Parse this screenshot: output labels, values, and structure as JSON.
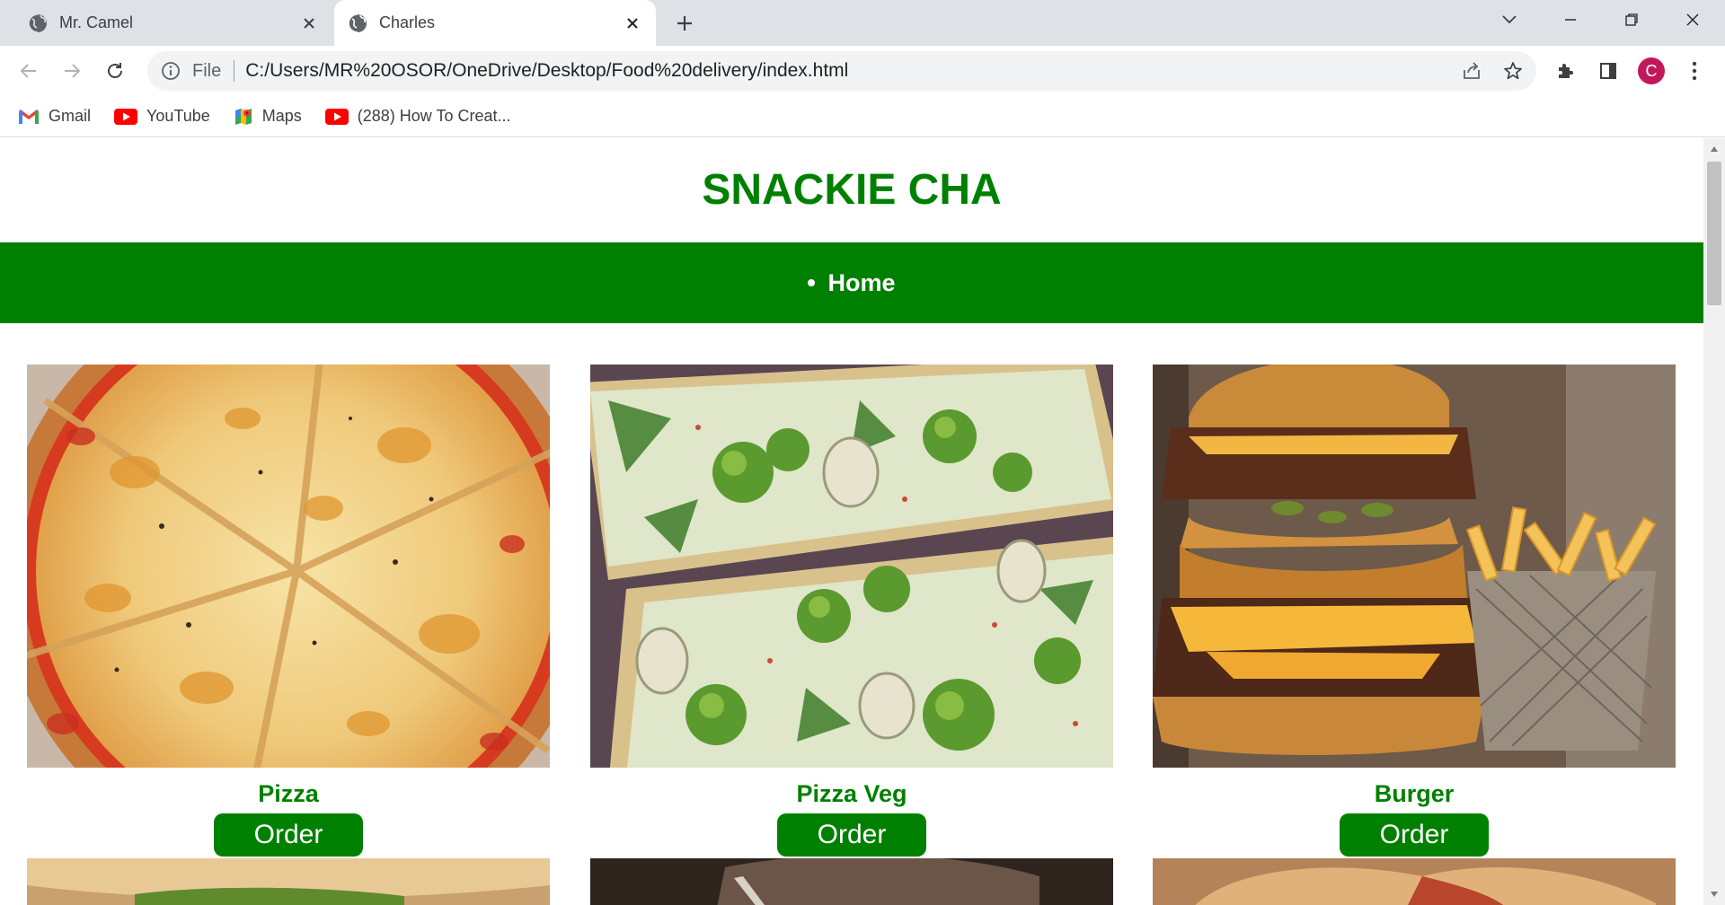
{
  "browser": {
    "tabs": [
      {
        "title": "Mr. Camel"
      },
      {
        "title": "Charles"
      }
    ],
    "omnibox": {
      "scheme_label": "File",
      "url": "C:/Users/MR%20OSOR/OneDrive/Desktop/Food%20delivery/index.html"
    },
    "profile_initial": "C",
    "bookmarks": [
      {
        "label": "Gmail",
        "icon": "gmail-icon"
      },
      {
        "label": "YouTube",
        "icon": "youtube-icon"
      },
      {
        "label": "Maps",
        "icon": "maps-icon"
      },
      {
        "label": "(288) How To Creat...",
        "icon": "youtube-icon"
      }
    ]
  },
  "site": {
    "title": "SNACKIE CHA",
    "nav": [
      {
        "label": "Home"
      }
    ],
    "brand_color": "#008000",
    "items": [
      {
        "name": "Pizza",
        "button": "Order",
        "image": "pizza-photo"
      },
      {
        "name": "Pizza Veg",
        "button": "Order",
        "image": "veggie-pizza-photo"
      },
      {
        "name": "Burger",
        "button": "Order",
        "image": "burger-photo"
      }
    ]
  }
}
